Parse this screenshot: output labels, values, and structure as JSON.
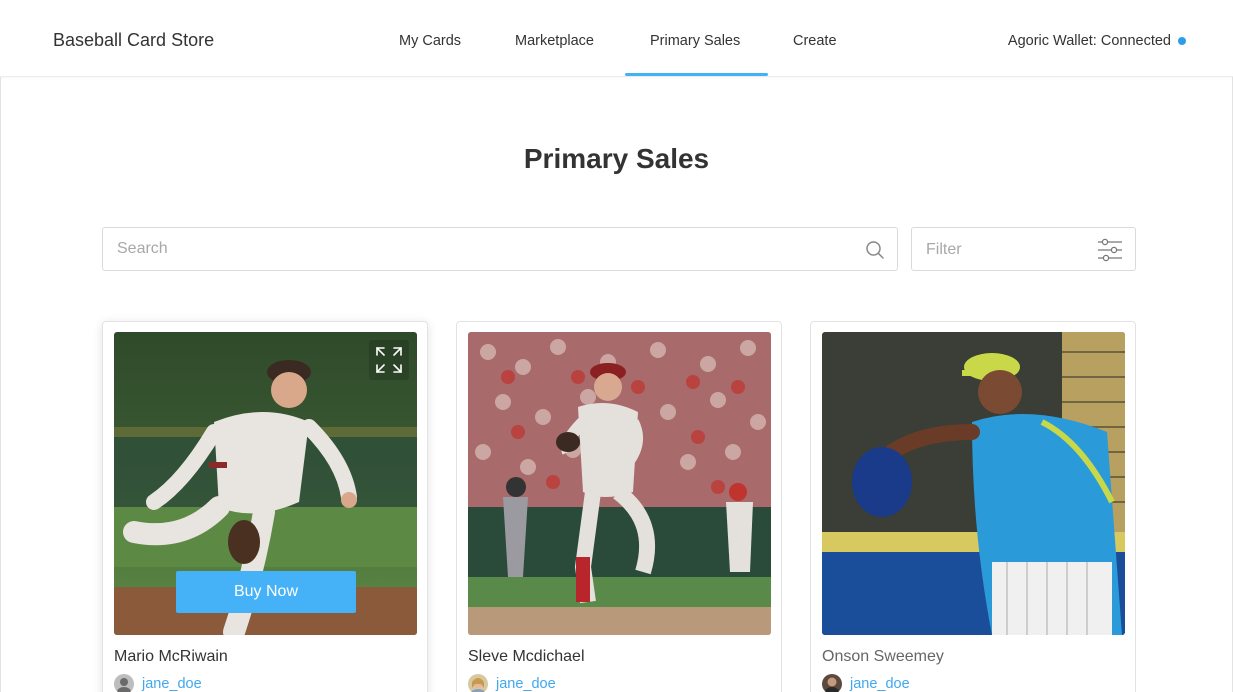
{
  "header": {
    "brand": "Baseball Card Store",
    "nav": [
      {
        "label": "My Cards",
        "active": false
      },
      {
        "label": "Marketplace",
        "active": false
      },
      {
        "label": "Primary Sales",
        "active": true
      },
      {
        "label": "Create",
        "active": false
      }
    ],
    "wallet_status": "Agoric Wallet: Connected",
    "wallet_dot_color": "#2c9ee8",
    "accent_color": "#41b3f5"
  },
  "page": {
    "title": "Primary Sales"
  },
  "search": {
    "placeholder": "Search",
    "value": "",
    "icon": "search-icon"
  },
  "filter": {
    "label": "Filter",
    "icon": "sliders-icon"
  },
  "cards": [
    {
      "name": "Mario McRiwain",
      "owner": "jane_doe",
      "buy_label": "Buy Now",
      "expand_icon": "expand-icon",
      "image": "pitcher-youth-photo"
    },
    {
      "name": "Sleve Mcdichael",
      "owner": "jane_doe",
      "image": "pitcher-stadium-crowd-photo"
    },
    {
      "name": "Onson Sweemey",
      "owner": "jane_doe",
      "image": "pitcher-blue-jersey-photo"
    }
  ]
}
